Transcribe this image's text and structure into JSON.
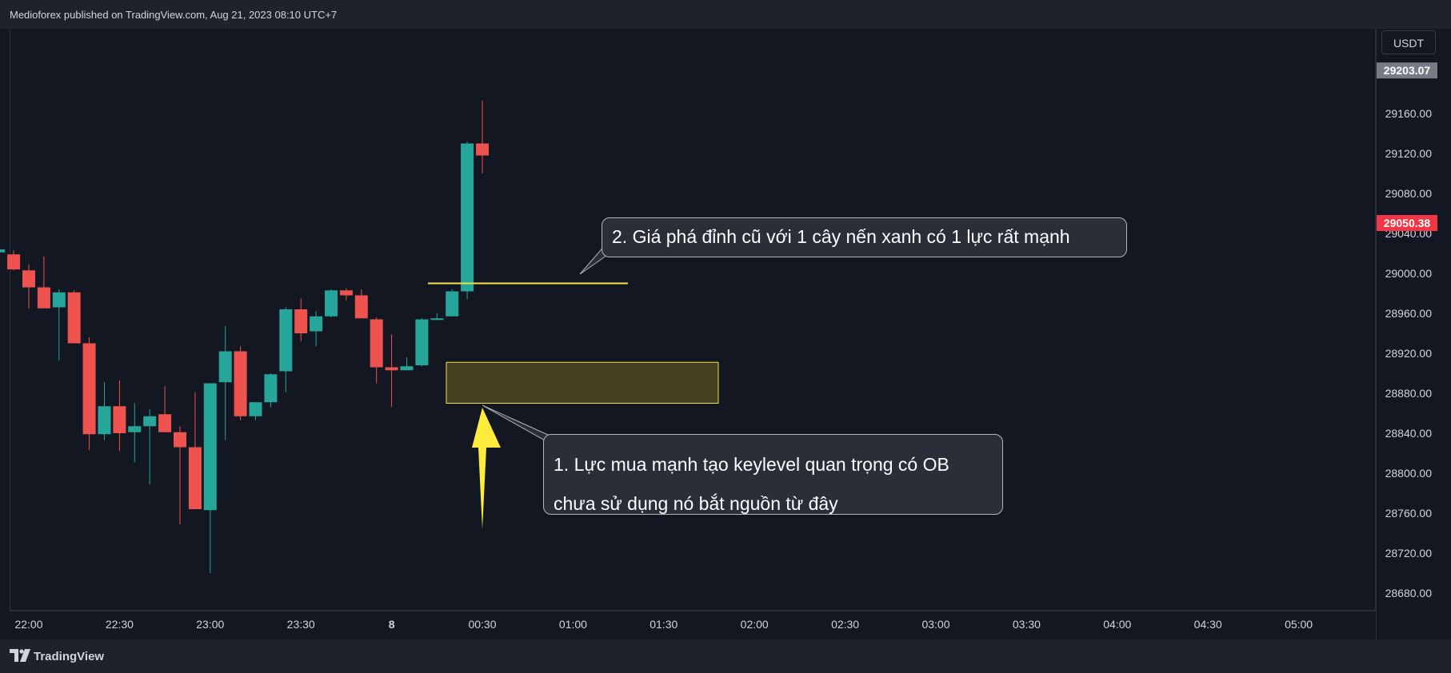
{
  "header": {
    "publisher_text": "Medioforex published on TradingView.com, Aug 21, 2023 08:10 UTC+7"
  },
  "footer": {
    "brand": "TradingView"
  },
  "price_scale": {
    "currency": "USDT"
  },
  "colors": {
    "bull": "#26a69a",
    "bear": "#ef5350",
    "background": "#131722",
    "level_line": "#f4e04d",
    "zone_fill": "#4a4520",
    "arrow": "#ffeb3b"
  },
  "chart_data": {
    "type": "candlestick",
    "interval_minutes": 10,
    "ylim": [
      28648,
      29220
    ],
    "y_ticks": [
      28680,
      28720,
      28760,
      28800,
      28840,
      28880,
      28920,
      28960,
      29000,
      29040,
      29080,
      29120,
      29160
    ],
    "x_ticks": [
      "22:00",
      "22:30",
      "23:00",
      "23:30",
      "8",
      "00:30",
      "01:00",
      "01:30",
      "02:00",
      "02:30",
      "03:00",
      "03:30",
      "04:00",
      "04:30",
      "05:00"
    ],
    "price_labels": [
      {
        "value": 29203.07,
        "text": "29203.07",
        "color": "#787b86"
      },
      {
        "value": 29050.38,
        "text": "29050.38",
        "color": "#f23645"
      }
    ],
    "candles": [
      {
        "t": "21:50",
        "o": 29021,
        "h": 29036,
        "l": 29018,
        "c": 29024
      },
      {
        "t": "21:55",
        "o": 29019,
        "h": 29023,
        "l": 29003,
        "c": 29004
      },
      {
        "t": "22:00",
        "o": 29003,
        "h": 29009,
        "l": 28965,
        "c": 28986
      },
      {
        "t": "22:05",
        "o": 28986,
        "h": 29017,
        "l": 28969,
        "c": 28965
      },
      {
        "t": "22:10",
        "o": 28966,
        "h": 28984,
        "l": 28913,
        "c": 28981
      },
      {
        "t": "22:15",
        "o": 28981,
        "h": 28983,
        "l": 28930,
        "c": 28930
      },
      {
        "t": "22:20",
        "o": 28930,
        "h": 28936,
        "l": 28823,
        "c": 28839
      },
      {
        "t": "22:25",
        "o": 28839,
        "h": 28891,
        "l": 28833,
        "c": 28867
      },
      {
        "t": "22:30",
        "o": 28867,
        "h": 28893,
        "l": 28822,
        "c": 28840
      },
      {
        "t": "22:35",
        "o": 28841,
        "h": 28870,
        "l": 28811,
        "c": 28847
      },
      {
        "t": "22:40",
        "o": 28847,
        "h": 28864,
        "l": 28789,
        "c": 28857
      },
      {
        "t": "22:45",
        "o": 28859,
        "h": 28887,
        "l": 28845,
        "c": 28841
      },
      {
        "t": "22:50",
        "o": 28841,
        "h": 28847,
        "l": 28749,
        "c": 28826
      },
      {
        "t": "22:55",
        "o": 28826,
        "h": 28881,
        "l": 28808,
        "c": 28764
      },
      {
        "t": "23:00",
        "o": 28763,
        "h": 28890,
        "l": 28700,
        "c": 28890
      },
      {
        "t": "23:05",
        "o": 28891,
        "h": 28947,
        "l": 28833,
        "c": 28922
      },
      {
        "t": "23:10",
        "o": 28922,
        "h": 28927,
        "l": 28853,
        "c": 28857
      },
      {
        "t": "23:15",
        "o": 28857,
        "h": 28870,
        "l": 28853,
        "c": 28871
      },
      {
        "t": "23:20",
        "o": 28871,
        "h": 28900,
        "l": 28866,
        "c": 28899
      },
      {
        "t": "23:25",
        "o": 28902,
        "h": 28966,
        "l": 28881,
        "c": 28964
      },
      {
        "t": "23:30",
        "o": 28964,
        "h": 28975,
        "l": 28932,
        "c": 28940
      },
      {
        "t": "23:35",
        "o": 28942,
        "h": 28962,
        "l": 28927,
        "c": 28957
      },
      {
        "t": "23:40",
        "o": 28957,
        "h": 28984,
        "l": 28956,
        "c": 28983
      },
      {
        "t": "23:45",
        "o": 28983,
        "h": 28985,
        "l": 28973,
        "c": 28978
      },
      {
        "t": "23:50",
        "o": 28978,
        "h": 28984,
        "l": 28965,
        "c": 28955
      },
      {
        "t": "23:55",
        "o": 28954,
        "h": 28956,
        "l": 28890,
        "c": 28906
      },
      {
        "t": "00:00",
        "o": 28906,
        "h": 28939,
        "l": 28866,
        "c": 28903
      },
      {
        "t": "00:05",
        "o": 28903,
        "h": 28916,
        "l": 28906,
        "c": 28907
      },
      {
        "t": "00:10",
        "o": 28908,
        "h": 28955,
        "l": 28907,
        "c": 28954
      },
      {
        "t": "00:15",
        "o": 28955,
        "h": 28960,
        "l": 28953,
        "c": 28955
      },
      {
        "t": "00:20",
        "o": 28957,
        "h": 28984,
        "l": 28957,
        "c": 28982
      },
      {
        "t": "00:25",
        "o": 28982,
        "h": 29132,
        "l": 28974,
        "c": 29130
      },
      {
        "t": "00:30",
        "o": 29130,
        "h": 29173,
        "l": 29100,
        "c": 29118
      }
    ],
    "annotations": {
      "callout_2": "2. Giá phá đỉnh cũ với 1 cây nến xanh có 1 lực rất mạnh",
      "callout_1_line1": "1. Lực mua mạnh tạo keylevel quan trọng có OB",
      "callout_1_line2": "chưa sử dụng nó bắt nguồn từ đây",
      "level_line_price": 28990,
      "order_block_zone": [
        28870,
        28911
      ]
    }
  }
}
